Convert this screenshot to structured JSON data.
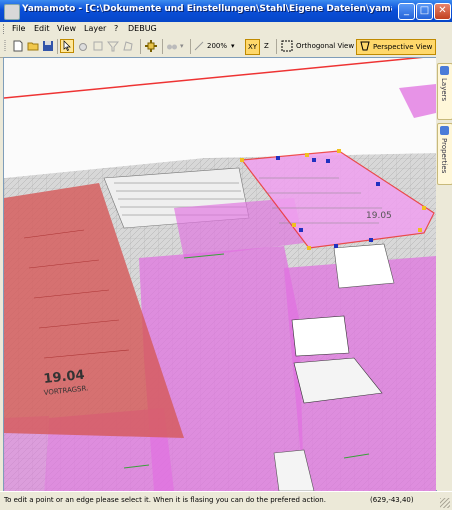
{
  "window": {
    "title": "Yamamoto - [C:\\Dokumente und Einstellungen\\Stahl\\Eigene Dateien\\yamamoto\\DFKI\\DFKI...",
    "minimize": "_",
    "maximize": "□",
    "close": "✕"
  },
  "menu": {
    "items": [
      "File",
      "Edit",
      "View",
      "Layer",
      "?",
      "DEBUG"
    ]
  },
  "toolbar": {
    "zoom": "200%",
    "xy_label": "XY",
    "z_label": "Z",
    "ortho_label": "Orthogonal View",
    "persp_label": "Perspective View"
  },
  "side_tabs": {
    "layers": "Layers",
    "properties": "Properties"
  },
  "room_labels": {
    "room_1904_number": "19.04",
    "room_1904_name": "VORTRAGSR.",
    "room_1905_number": "19.05"
  },
  "status": {
    "message": "To edit a point or an edge please select it. When it is flasing you can do the prefered action.",
    "coords": "(629,-43,40)"
  },
  "colors": {
    "selected_room": "#f0a0f0",
    "room": "#e070e0",
    "red_room": "#d65a5a",
    "vertex": "#f0c020",
    "vertex_selected": "#2030c0",
    "accent": "#ffd86b"
  }
}
